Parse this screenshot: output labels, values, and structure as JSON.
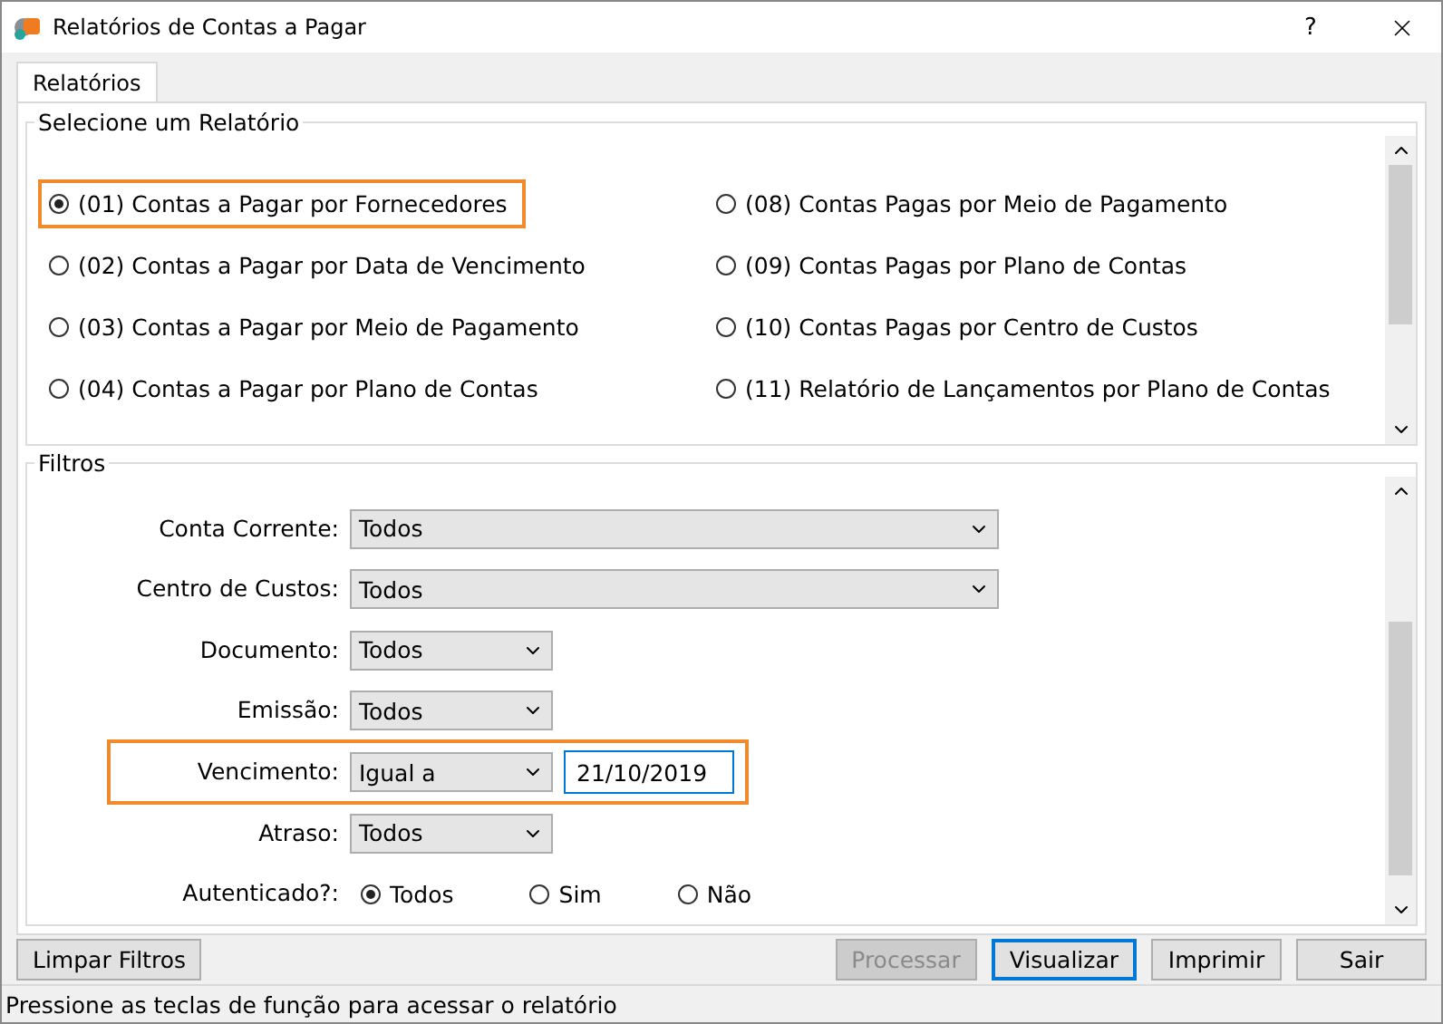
{
  "window": {
    "title": "Relatórios de Contas a Pagar",
    "help": "?"
  },
  "tabs": [
    {
      "label": "Relatórios",
      "selected": true
    }
  ],
  "reports": {
    "title": "Selecione um Relatório",
    "columns": [
      {
        "options": [
          {
            "label": "(01) Contas a Pagar por Fornecedores",
            "selected": true,
            "highlighted": true
          },
          {
            "label": "(02) Contas a Pagar por Data de Vencimento",
            "selected": false,
            "highlighted": false
          },
          {
            "label": "(03) Contas a Pagar por Meio de Pagamento",
            "selected": false,
            "highlighted": false
          },
          {
            "label": "(04) Contas a Pagar por Plano de Contas",
            "selected": false,
            "highlighted": false
          }
        ]
      },
      {
        "options": [
          {
            "label": "(08) Contas Pagas por Meio de Pagamento",
            "selected": false,
            "highlighted": false
          },
          {
            "label": "(09) Contas Pagas por Plano de Contas",
            "selected": false,
            "highlighted": false
          },
          {
            "label": "(10) Contas Pagas por Centro de Custos",
            "selected": false,
            "highlighted": false
          },
          {
            "label": "(11) Relatório de Lançamentos por Plano de Contas",
            "selected": false,
            "highlighted": false
          }
        ]
      }
    ]
  },
  "filters": {
    "title": "Filtros",
    "rows": [
      {
        "kind": "wide_select",
        "label": "Conta Corrente:",
        "value": "Todos",
        "highlighted": false
      },
      {
        "kind": "wide_select",
        "label": "Centro de Custos:",
        "value": "Todos",
        "highlighted": false
      },
      {
        "kind": "select",
        "label": "Documento:",
        "value": "Todos",
        "highlighted": false
      },
      {
        "kind": "select",
        "label": "Emissão:",
        "value": "Todos",
        "highlighted": false
      },
      {
        "kind": "select_date",
        "label": "Vencimento:",
        "value": "Igual a",
        "date": "21/10/2019",
        "highlighted": true
      },
      {
        "kind": "select",
        "label": "Atraso:",
        "value": "Todos",
        "highlighted": false
      },
      {
        "kind": "radios",
        "label": "Autenticado?:",
        "highlighted": false,
        "options": [
          {
            "label": "Todos",
            "selected": true
          },
          {
            "label": "Sim",
            "selected": false
          },
          {
            "label": "Não",
            "selected": false
          }
        ]
      }
    ]
  },
  "buttons": [
    {
      "label": "Limpar Filtros",
      "disabled": false,
      "focused": false
    },
    {
      "label": "Processar",
      "disabled": true,
      "focused": false
    },
    {
      "label": "Visualizar",
      "disabled": false,
      "focused": true
    },
    {
      "label": "Imprimir",
      "disabled": false,
      "focused": false
    },
    {
      "label": "Sair",
      "disabled": false,
      "focused": false
    }
  ],
  "status_bar": "Pressione as teclas de função para acessar o relatório"
}
